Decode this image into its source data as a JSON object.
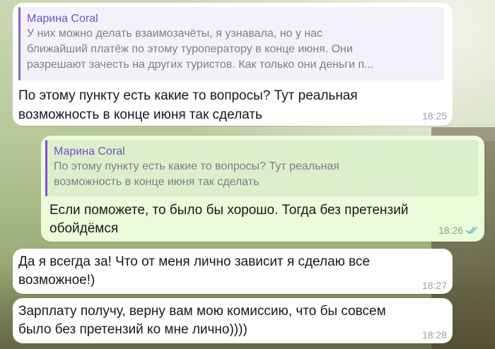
{
  "messages": [
    {
      "quote": {
        "author": "Марина Coral",
        "lines": [
          "У них можно делать взаимозачёты, я узнавала, но у нас",
          "ближайший платёж по этому туроператору в конце июня. Они",
          "разрешают зачесть на других туристов. Как только они деньги п..."
        ]
      },
      "lines": [
        "По этому пункту есть какие то вопросы? Тут реальная",
        "возможность в конце июня так сделать"
      ],
      "time": "18:25"
    },
    {
      "quote": {
        "author": "Марина Coral",
        "lines": [
          "По этому пункту есть какие то вопросы? Тут реальная",
          "возможность в конце июня так сделать"
        ]
      },
      "lines": [
        "Если поможете, то было бы хорошо. Тогда без претензий",
        "обойдёмся"
      ],
      "time": "18:26"
    },
    {
      "lines": [
        "Да я всегда за! Что от меня лично зависит я сделаю все",
        "возможное!)"
      ],
      "time": "18:27"
    },
    {
      "lines": [
        "Зарплату получу, верну вам мою комиссию, что бы совсем",
        "было без претензий ко мне лично))))"
      ],
      "time": "18:28"
    }
  ],
  "colors": {
    "incoming_bubble": "#ffffff",
    "outgoing_bubble": "#eafcd9",
    "quote_accent": "#8463d6",
    "read_ticks": "#5fa6e0"
  },
  "icons": {
    "read_status": "double-check-icon"
  }
}
